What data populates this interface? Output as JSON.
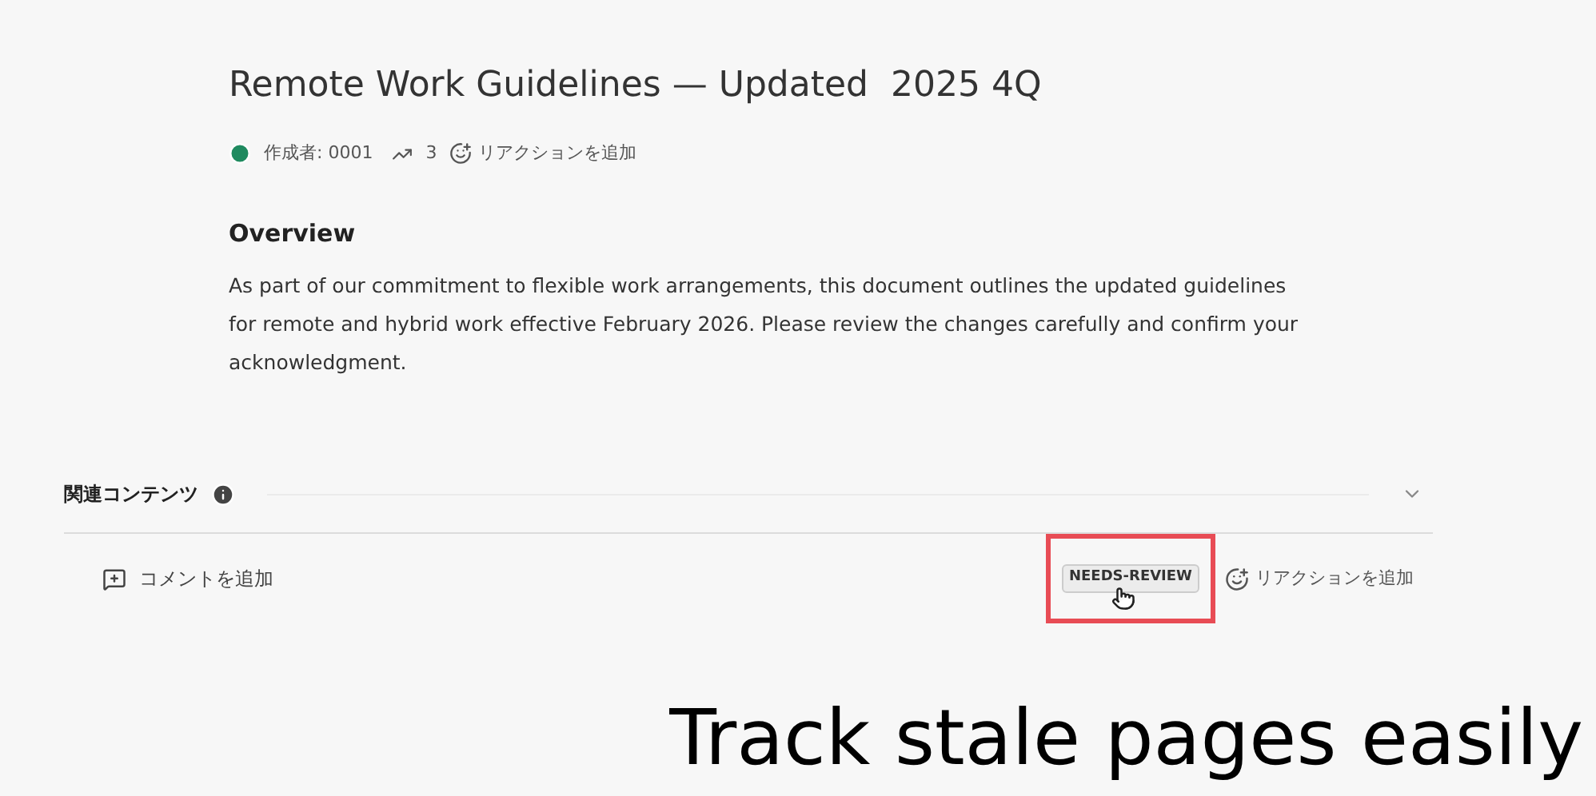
{
  "page": {
    "title": "Remote Work Guidelines — Updated  2025 4Q",
    "meta": {
      "author": "作成者: 0001",
      "views": "3",
      "add_reaction": "リアクションを追加"
    },
    "section_heading": "Overview",
    "body": "As part of our commitment to flexible work arrangements, this document outlines the updated guidelines for remote and hybrid work effective February 2026. Please review the changes carefully and confirm your acknowledgment."
  },
  "related": {
    "label": "関連コンテンツ",
    "expanded": false
  },
  "footer": {
    "add_comment": "コメントを追加",
    "tag": "NEEDS-REVIEW",
    "add_reaction": "リアクションを追加"
  },
  "caption": "Track stale pages easily"
}
